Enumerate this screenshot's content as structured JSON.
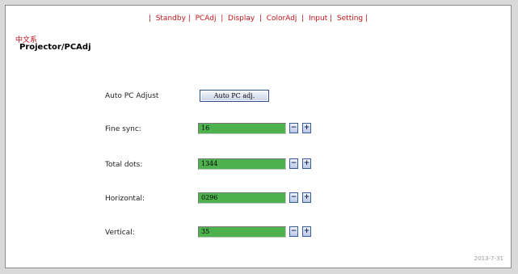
{
  "nav": {
    "items": [
      "Standby",
      "PCAdj",
      "Display",
      "ColorAdj",
      "Input",
      "Setting"
    ]
  },
  "language_link": "中文系",
  "breadcrumb": "Projector/PCAdj",
  "auto_adjust": {
    "label": "Auto PC Adjust",
    "button_label": "Auto PC adj."
  },
  "rows": [
    {
      "label": "Fine sync:",
      "value": "16"
    },
    {
      "label": "Total dots:",
      "value": "1344"
    },
    {
      "label": "Horizontal:",
      "value": "0296"
    },
    {
      "label": "Vertical:",
      "value": "35"
    }
  ],
  "stepper": {
    "minus": "−",
    "plus": "+"
  },
  "footer_date": "2013-7-31",
  "colors": {
    "accent": "#c0141b",
    "field_bg": "#4db24d",
    "button_border": "#2f4f8c"
  }
}
